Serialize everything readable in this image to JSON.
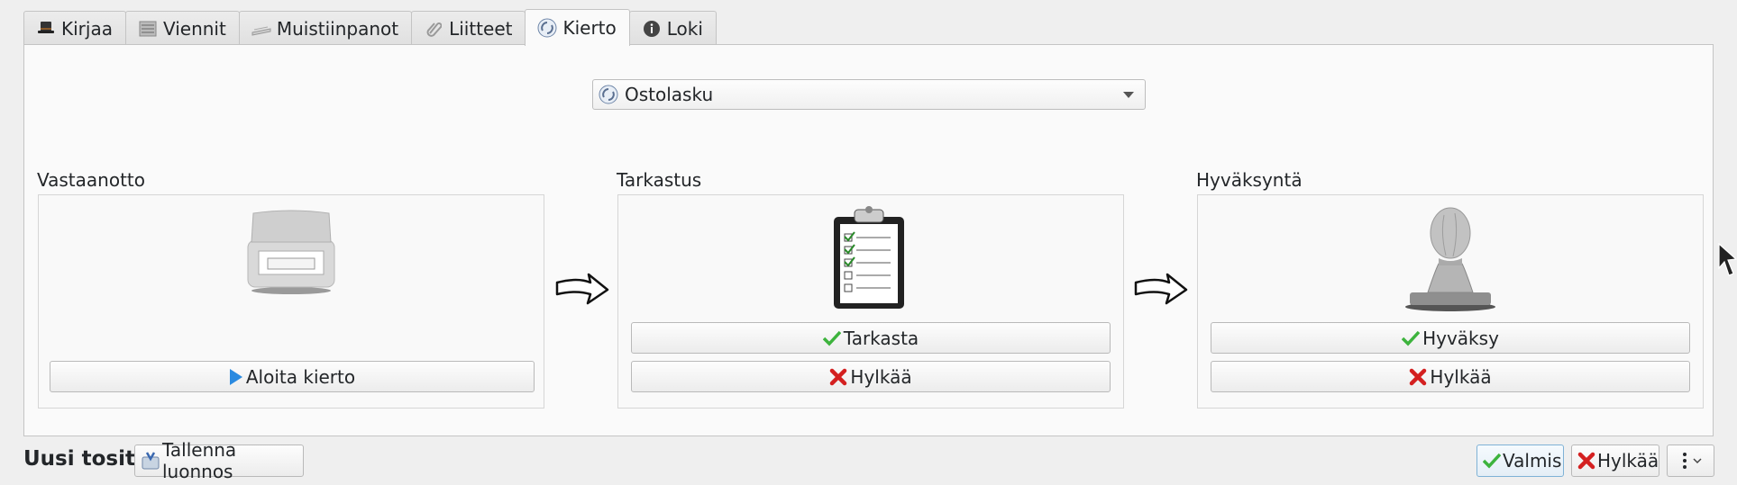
{
  "tabs": [
    {
      "label": "Kirjaa",
      "icon": "hat-icon",
      "active": false
    },
    {
      "label": "Viennit",
      "icon": "list-icon",
      "active": false
    },
    {
      "label": "Muistiinpanot",
      "icon": "notes-icon",
      "active": false
    },
    {
      "label": "Liitteet",
      "icon": "paperclip-icon",
      "active": false
    },
    {
      "label": "Kierto",
      "icon": "circulation-icon",
      "active": true
    },
    {
      "label": "Loki",
      "icon": "info-icon",
      "active": false
    }
  ],
  "workflow": {
    "selected": "Ostolasku",
    "stages": [
      {
        "title": "Vastaanotto",
        "icon": "scanner-icon",
        "buttons": [
          {
            "label": "Aloita kierto",
            "icon": "play-icon"
          }
        ]
      },
      {
        "title": "Tarkastus",
        "icon": "clipboard-checklist-icon",
        "buttons": [
          {
            "label": "Tarkasta",
            "icon": "check-icon"
          },
          {
            "label": "Hylkää",
            "icon": "cross-icon"
          }
        ]
      },
      {
        "title": "Hyväksyntä",
        "icon": "stamp-icon",
        "buttons": [
          {
            "label": "Hyväksy",
            "icon": "check-icon"
          },
          {
            "label": "Hylkää",
            "icon": "cross-icon"
          }
        ]
      }
    ]
  },
  "footer": {
    "title": "Uusi tosite",
    "save_draft": "Tallenna luonnos",
    "done": "Valmis",
    "reject": "Hylkää"
  },
  "colors": {
    "check": "#3db33d",
    "cross": "#d42020",
    "play": "#2a8ae0"
  }
}
